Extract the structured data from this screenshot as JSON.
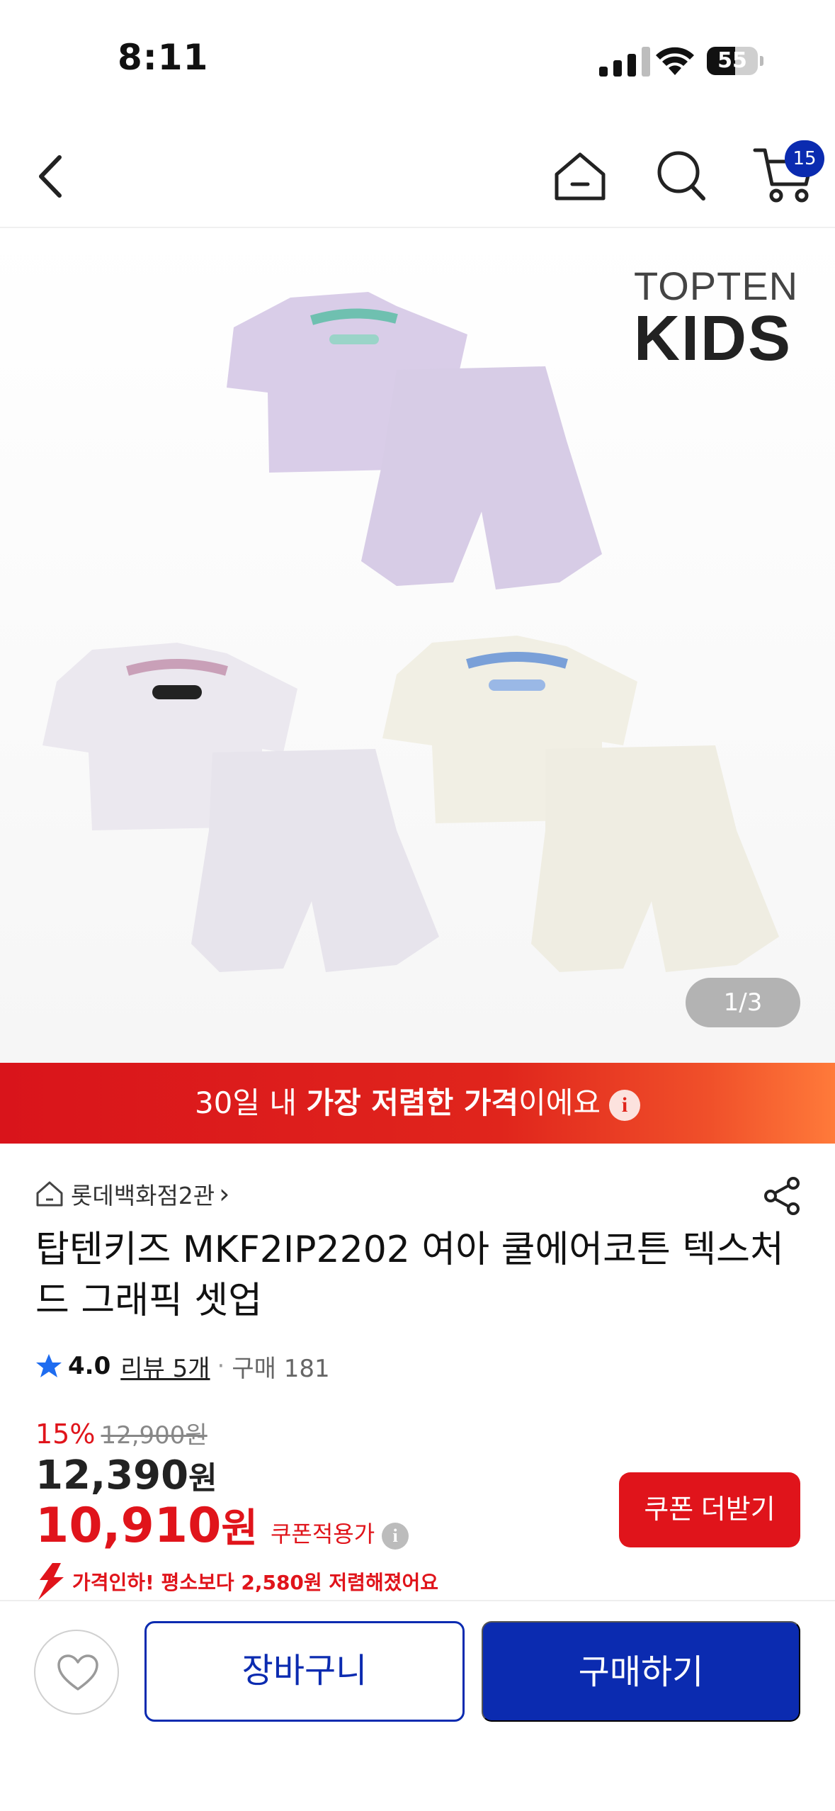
{
  "status_bar": {
    "time": "8:11",
    "battery": "55",
    "battery_level": 0.55
  },
  "nav": {
    "cart_count": "15"
  },
  "gallery": {
    "brand_line1": "TOPTEN",
    "brand_line2": "KIDS",
    "counter_current": "1",
    "counter_sep": "/",
    "counter_total": "3"
  },
  "banner": {
    "prefix": "30일 내 ",
    "emphasis": "가장 저렴한 가격",
    "suffix": "이에요",
    "info_glyph": "i"
  },
  "product": {
    "store": "롯데백화점2관",
    "store_arrow": "›",
    "title": "탑텐키즈 MKF2IP2202 여아 쿨에어코튼 텍스처드 그래픽 셋업",
    "rating": "4.0",
    "review": "리뷰 5개",
    "dot": "·",
    "purchase": "구매 181"
  },
  "pricing": {
    "discount_rate": "15%",
    "original_price": "12,900원",
    "sale_price": "12,390",
    "sale_unit": "원",
    "coupon_price": "10,910",
    "coupon_unit": "원",
    "coupon_label": "쿠폰적용가",
    "coupon_info": "i",
    "coupon_button": "쿠폰 더받기",
    "drop_message": "가격인하! 평소보다 2,580원 저렴해졌어요"
  },
  "actions": {
    "cart_label": "장바구니",
    "buy_label": "구매하기"
  },
  "colors": {
    "accent_blue": "#0b2bb0",
    "accent_red": "#e0141b"
  }
}
